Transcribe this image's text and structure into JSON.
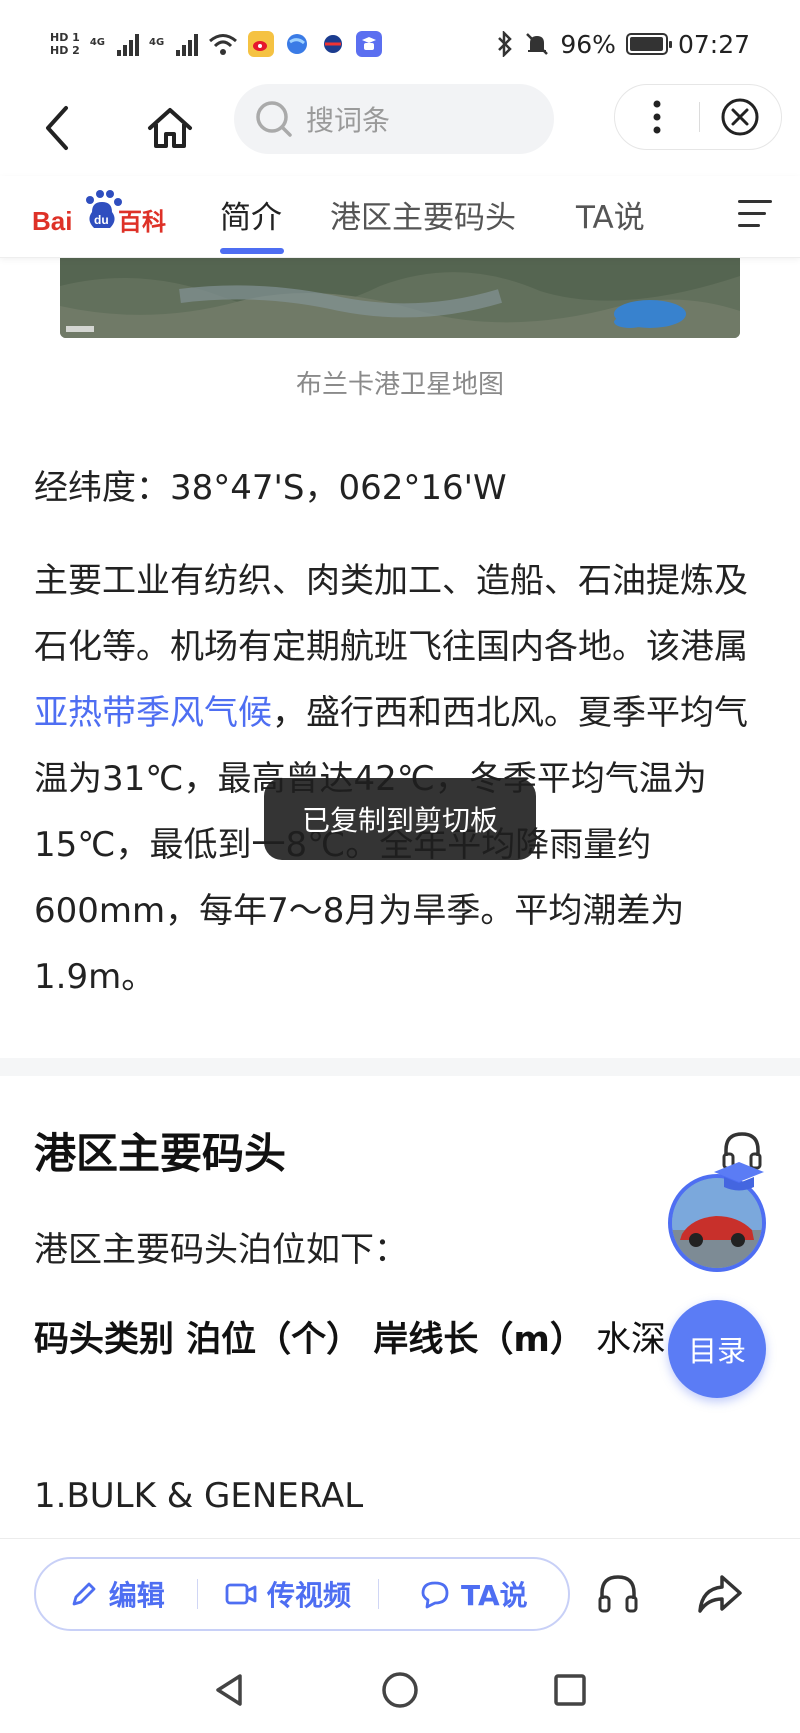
{
  "status_bar": {
    "hd1": "HD 1",
    "hd2": "HD 2",
    "net1": "4G",
    "net2": "4G",
    "battery_text": "96%",
    "battery_level": 0.96,
    "time": "07:27",
    "app_icons": [
      "weibo-icon",
      "browser-icon",
      "vpn-icon",
      "baike-app-icon"
    ]
  },
  "browser": {
    "search_placeholder": "搜词条"
  },
  "nav": {
    "logo_text": "Bai du 百科",
    "tabs": [
      "简介",
      "港区主要码头",
      "TA说"
    ],
    "active_tab": "简介",
    "accent": "#4e6ef2"
  },
  "article": {
    "map_caption": "布兰卡港卫星地图",
    "coords": "经纬度：38°47'S，062°16'W",
    "para_part1": "主要工业有纺织、肉类加工、造船、石油提炼及石化等。机场有定期航班飞往国内各地。该港属",
    "para_link": "亚热带季风气候",
    "para_part2": "，盛行西和西北风。夏季平均气温为31℃，最高曾达42℃，冬季平均气温为15℃，最低到一8℃。全年平均降雨量约600mm，每年7～8月为旱季。平均潮差为1.9m。",
    "section_title": "港区主要码头",
    "section_sub": "港区主要码头泊位如下：",
    "table_header_bold": "码头类别 泊位（个） 岸线长（m）",
    "table_header_rest": " 水深（m）",
    "bulk": "1.BULK & GENERAL"
  },
  "floating": {
    "toc_label": "目录"
  },
  "toast": {
    "text": "已复制到剪切板"
  },
  "bottom_bar": {
    "edit_label": "编辑",
    "video_label": "传视频",
    "talk_label": "TA说"
  }
}
